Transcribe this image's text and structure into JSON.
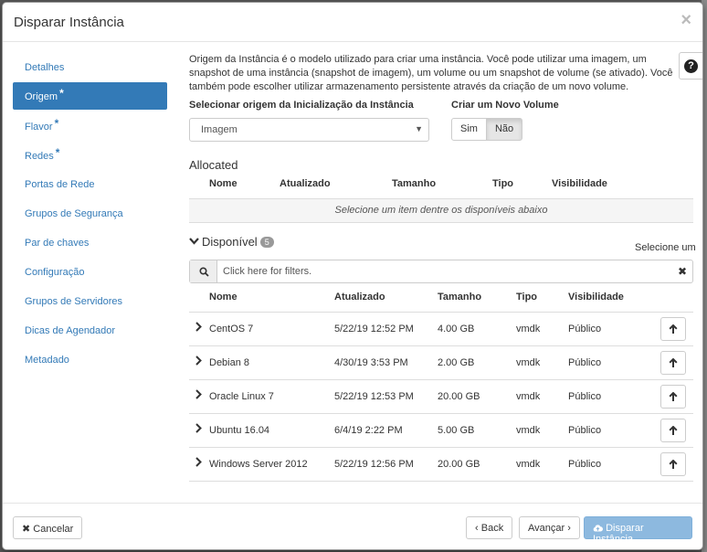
{
  "modal": {
    "title": "Disparar Instância",
    "close": "×"
  },
  "sidebar": {
    "items": [
      {
        "label": "Detalhes",
        "required": ""
      },
      {
        "label": "Origem",
        "required": "*"
      },
      {
        "label": "Flavor",
        "required": "*"
      },
      {
        "label": "Redes",
        "required": "*"
      },
      {
        "label": "Portas de Rede",
        "required": ""
      },
      {
        "label": "Grupos de Segurança",
        "required": ""
      },
      {
        "label": "Par de chaves",
        "required": ""
      },
      {
        "label": "Configuração",
        "required": ""
      },
      {
        "label": "Grupos de Servidores",
        "required": ""
      },
      {
        "label": "Dicas de Agendador",
        "required": ""
      },
      {
        "label": "Metadado",
        "required": ""
      }
    ]
  },
  "source": {
    "description": "Origem da Instância é o modelo utilizado para criar uma instância. Você pode utilizar uma imagem, um snapshot de uma instância (snapshot de imagem), um volume ou um snapshot de volume (se ativado). Você também pode escolher utilizar armazenamento persistente através da criação de um novo volume.",
    "help": "?",
    "boot_source_label": "Selecionar origem da Inicialização da Instância",
    "boot_source_value": "Imagem",
    "new_volume_label": "Criar um Novo Volume",
    "yes": "Sim",
    "no": "Não"
  },
  "allocated": {
    "title": "Allocated",
    "headers": [
      "Nome",
      "Atualizado",
      "Tamanho",
      "Tipo",
      "Visibilidade"
    ],
    "empty": "Selecione um item dentre os disponíveis abaixo"
  },
  "available": {
    "title": "Disponível",
    "count": "5",
    "select_hint": "Selecione um",
    "filter_placeholder": "Click here for filters.",
    "headers": [
      "Nome",
      "Atualizado",
      "Tamanho",
      "Tipo",
      "Visibilidade"
    ],
    "rows": [
      {
        "name": "CentOS 7",
        "updated": "5/22/19 12:52 PM",
        "size": "4.00 GB",
        "type": "vmdk",
        "visibility": "Público"
      },
      {
        "name": "Debian 8",
        "updated": "4/30/19 3:53 PM",
        "size": "2.00 GB",
        "type": "vmdk",
        "visibility": "Público"
      },
      {
        "name": "Oracle Linux 7",
        "updated": "5/22/19 12:53 PM",
        "size": "20.00 GB",
        "type": "vmdk",
        "visibility": "Público"
      },
      {
        "name": "Ubuntu 16.04",
        "updated": "6/4/19 2:22 PM",
        "size": "5.00 GB",
        "type": "vmdk",
        "visibility": "Público"
      },
      {
        "name": "Windows Server 2012",
        "updated": "5/22/19 12:56 PM",
        "size": "20.00 GB",
        "type": "vmdk",
        "visibility": "Público"
      }
    ]
  },
  "footer": {
    "cancel": "Cancelar",
    "back": "Back",
    "next": "Avançar",
    "launch": "Disparar Instância"
  }
}
